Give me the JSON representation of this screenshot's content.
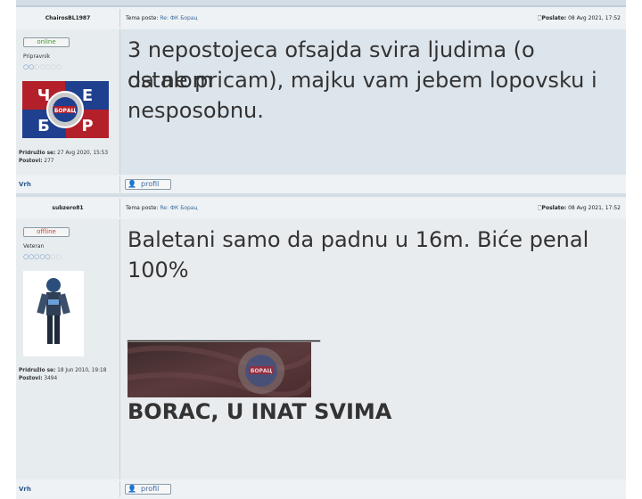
{
  "posts": [
    {
      "author": "ChairosBL1987",
      "topic_label": "Tema poste:",
      "topic_link": "Re: ФК Борац",
      "posted_label": "Poslato:",
      "posted_date": "08 Avg 2021, 17:52",
      "status": "online",
      "rank": "Pripravnik",
      "rank_stars_filled": 2,
      "rank_stars_total": 7,
      "joined_label": "Pridružio se:",
      "joined": "27 Avg 2020, 15:53",
      "posts_label": "Postovi:",
      "posts_count": "277",
      "message": [
        "3 nepostojeca ofsajda svira ljudima (o ostalom",
        "da ne pricam), majku vam jebem lopovsku i",
        "nesposobnu."
      ],
      "top_link": "Vrh",
      "profile_button": "profil"
    },
    {
      "author": "subzero81",
      "topic_label": "Tema poste:",
      "topic_link": "Re: ФК Борац",
      "posted_label": "Poslato:",
      "posted_date": "08 Avg 2021, 17:52",
      "status": "offline",
      "rank": "Veteran",
      "rank_stars_filled": 5,
      "rank_stars_total": 7,
      "joined_label": "Pridružio se:",
      "joined": "18 Jun 2010, 19:18",
      "posts_label": "Postovi:",
      "posts_count": "3494",
      "message": [
        "Baletani samo da padnu u 16m. Biće penal",
        "100%"
      ],
      "signature_line": "__________________",
      "signature_text": "BORAC, U INAT SVIMA",
      "top_link": "Vrh",
      "profile_button": "profil"
    }
  ],
  "colors": {
    "link": "#3a6a9c",
    "online": "#3e9b2f",
    "offline": "#c04a3a",
    "borac_blue": "#1f3f8f",
    "borac_red": "#b3202a"
  },
  "icons": [
    "post-icon",
    "profile-icon"
  ]
}
